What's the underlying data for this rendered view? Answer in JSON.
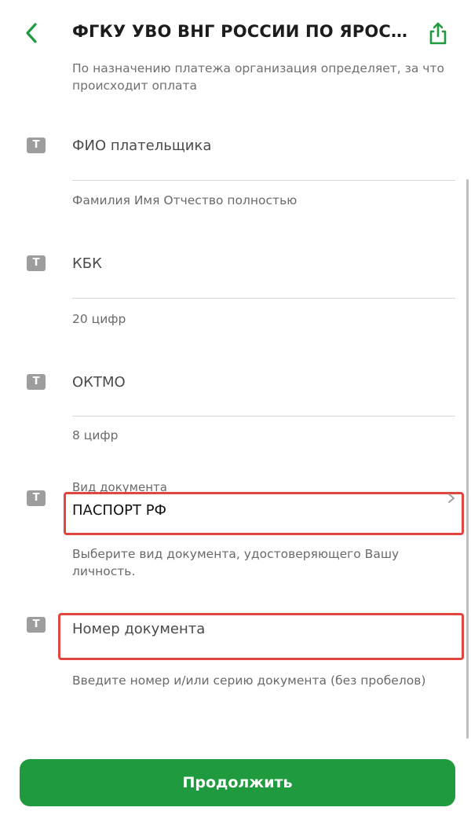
{
  "header": {
    "title": "ФГКУ УВО ВНГ РОССИИ ПО ЯРОС…",
    "back_icon": "chevron-left-icon",
    "share_icon": "share-icon",
    "accent_color": "#1f9a3e"
  },
  "top_description": "По назначению платежа организация определяет, за что происходит оплата",
  "fields": {
    "fio": {
      "icon": "T",
      "label": "ФИО плательщика",
      "hint": "Фамилия Имя Отчество полностью"
    },
    "kbk": {
      "icon": "T",
      "label": "КБК",
      "hint": "20 цифр"
    },
    "oktmo": {
      "icon": "T",
      "label": "ОКТМО",
      "hint": "8 цифр"
    },
    "doc_type": {
      "icon": "T",
      "caption": "Вид документа",
      "value": "ПАСПОРТ РФ",
      "hint": "Выберите вид документа, удостоверяющего Вашу личность."
    },
    "doc_number": {
      "icon": "T",
      "placeholder": "Номер документа",
      "hint": "Введите номер и/или серию документа (без пробелов)"
    }
  },
  "highlight_color": "#e0463e",
  "continue_button": {
    "label": "Продолжить"
  }
}
